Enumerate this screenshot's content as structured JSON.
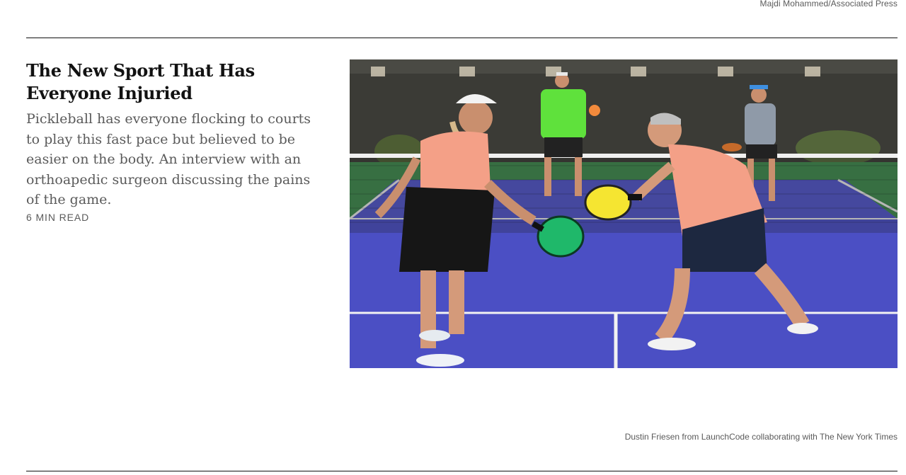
{
  "top_credit": "Majdi Mohammed/Associated Press",
  "article": {
    "headline": "The New Sport That Has Everyone Injuried",
    "summary": "Pickleball has everyone flocking to courts to play this fast pace but believed to be easier on the body. An interview with an orthoapedic surgeon discussing the pains of the game.",
    "read_time": "6 MIN READ"
  },
  "image": {
    "alt": "Four people playing pickleball on a blue court",
    "icon": "pickleball-photo"
  },
  "photo_credit": "Dustin Friesen from LaunchCode collaborating with The New York Times",
  "colors": {
    "court": "#4b4fc4",
    "court_outer": "#3f8a4e",
    "fence": "#3b3b36",
    "shirt_salmon": "#f4a087",
    "shirt_green": "#5fe13c",
    "paddle_yellow": "#f5e531",
    "paddle_green": "#1fb86a"
  }
}
